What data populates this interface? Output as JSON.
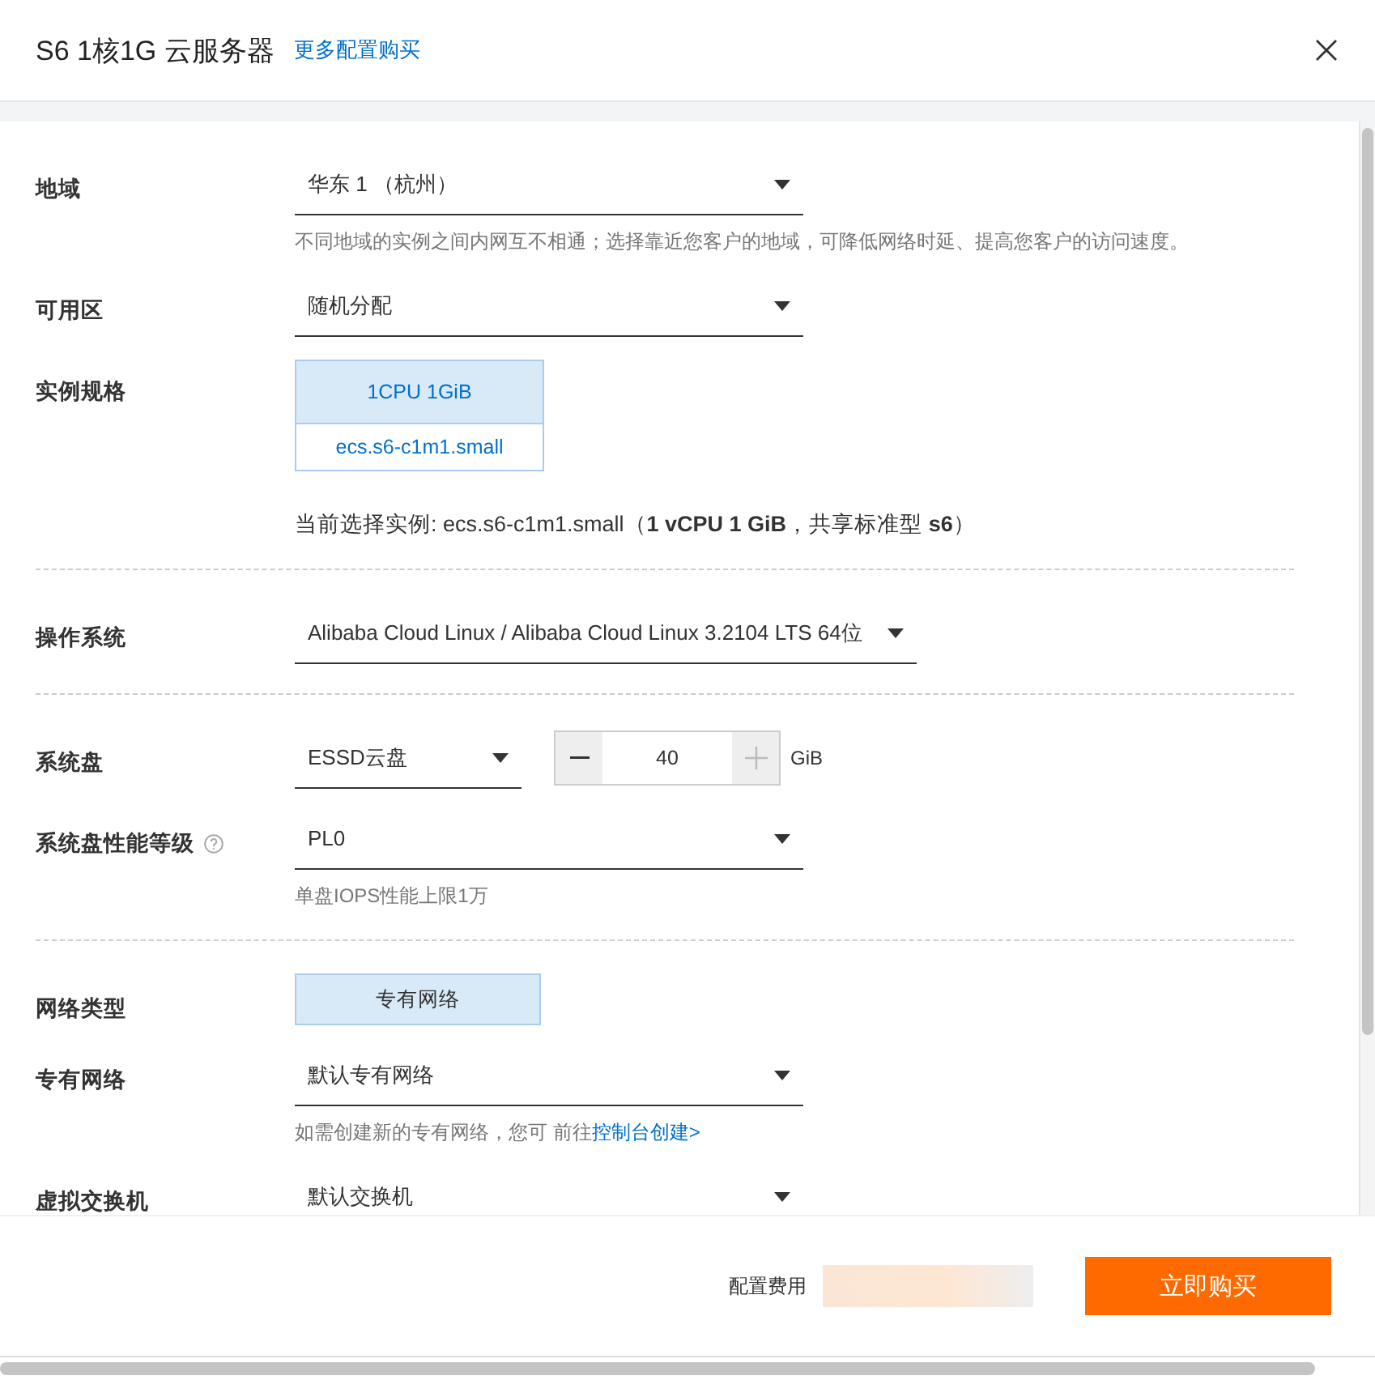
{
  "dialog": {
    "title": "S6 1核1G 云服务器",
    "link": "更多配置购买"
  },
  "sections": [
    {
      "rows": [
        {
          "kind": "select",
          "label": "地域",
          "value": "华东 1 （杭州）",
          "hint": "不同地域的实例之间内网互不相通；选择靠近您客户的地域，可降低网络时延、提高您客户的访问速度。"
        },
        {
          "kind": "select",
          "label": "可用区",
          "value": "随机分配"
        },
        {
          "kind": "spec",
          "label": "实例规格",
          "spec_header": "1CPU 1GiB",
          "spec_name": "ecs.s6-c1m1.small",
          "note": "当前选择实例: ecs.s6-c1m1.small（**1 vCPU 1 GiB**，共享标准型 **s6**）"
        }
      ]
    },
    {
      "rows": [
        {
          "kind": "select",
          "label": "操作系统",
          "value": "Alibaba Cloud Linux / Alibaba Cloud Linux 3.2104 LTS 64位"
        }
      ]
    },
    {
      "rows": [
        {
          "kind": "disk",
          "label": "系统盘",
          "value": "ESSD云盘",
          "amount": "40",
          "unit": "GiB"
        },
        {
          "kind": "select",
          "label": "系统盘性能等级",
          "help": true,
          "value": "PL0",
          "hint": "单盘IOPS性能上限1万"
        }
      ]
    },
    {
      "rows": [
        {
          "kind": "choice",
          "label": "网络类型",
          "options": [
            {
              "label": "专有网络",
              "selected": true
            }
          ]
        },
        {
          "kind": "select",
          "label": "专有网络",
          "value": "默认专有网络",
          "hint": "如需创建新的专有网络，您可 前往",
          "link": "控制台创建>"
        },
        {
          "kind": "select",
          "label": "虚拟交换机",
          "value": "默认交换机"
        }
      ]
    }
  ],
  "footer": {
    "price_label": "配置费用",
    "buy_button": "立即购买"
  }
}
